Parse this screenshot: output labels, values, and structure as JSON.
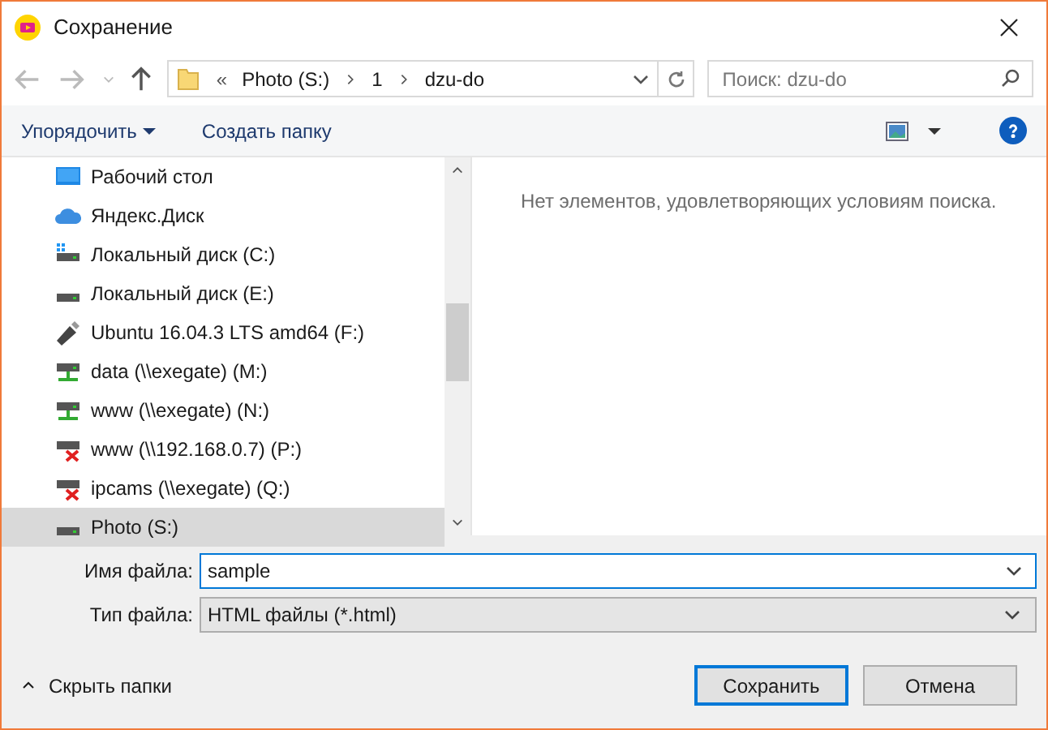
{
  "window": {
    "title": "Сохранение"
  },
  "address": {
    "overflow": "«",
    "crumbs": [
      "Photo (S:)",
      "1",
      "dzu-do"
    ]
  },
  "search": {
    "placeholder": "Поиск: dzu-do"
  },
  "toolbar": {
    "organize": "Упорядочить",
    "new_folder": "Создать папку"
  },
  "sidebar": {
    "items": [
      {
        "label": "Рабочий стол",
        "kind": "desktop",
        "selected": false
      },
      {
        "label": "Яндекс.Диск",
        "kind": "cloud",
        "selected": false
      },
      {
        "label": "Локальный диск (C:)",
        "kind": "system-drive",
        "selected": false
      },
      {
        "label": "Локальный диск (E:)",
        "kind": "drive",
        "selected": false
      },
      {
        "label": "Ubuntu 16.04.3 LTS amd64 (F:)",
        "kind": "usb",
        "selected": false
      },
      {
        "label": "data (\\\\exegate) (M:)",
        "kind": "network",
        "selected": false
      },
      {
        "label": "www (\\\\exegate) (N:)",
        "kind": "network",
        "selected": false
      },
      {
        "label": "www (\\\\192.168.0.7) (P:)",
        "kind": "network-offline",
        "selected": false
      },
      {
        "label": "ipcams (\\\\exegate) (Q:)",
        "kind": "network-offline",
        "selected": false
      },
      {
        "label": "Photo (S:)",
        "kind": "drive",
        "selected": true
      }
    ]
  },
  "content": {
    "empty_message": "Нет элементов, удовлетворяющих условиям поиска."
  },
  "form": {
    "file_name_label": "Имя файла:",
    "file_name": "sample",
    "file_type_label": "Тип файла:",
    "file_type": "HTML файлы (*.html)"
  },
  "hide_folders": "Скрыть папки",
  "buttons": {
    "save": "Сохранить",
    "cancel": "Отмена"
  }
}
